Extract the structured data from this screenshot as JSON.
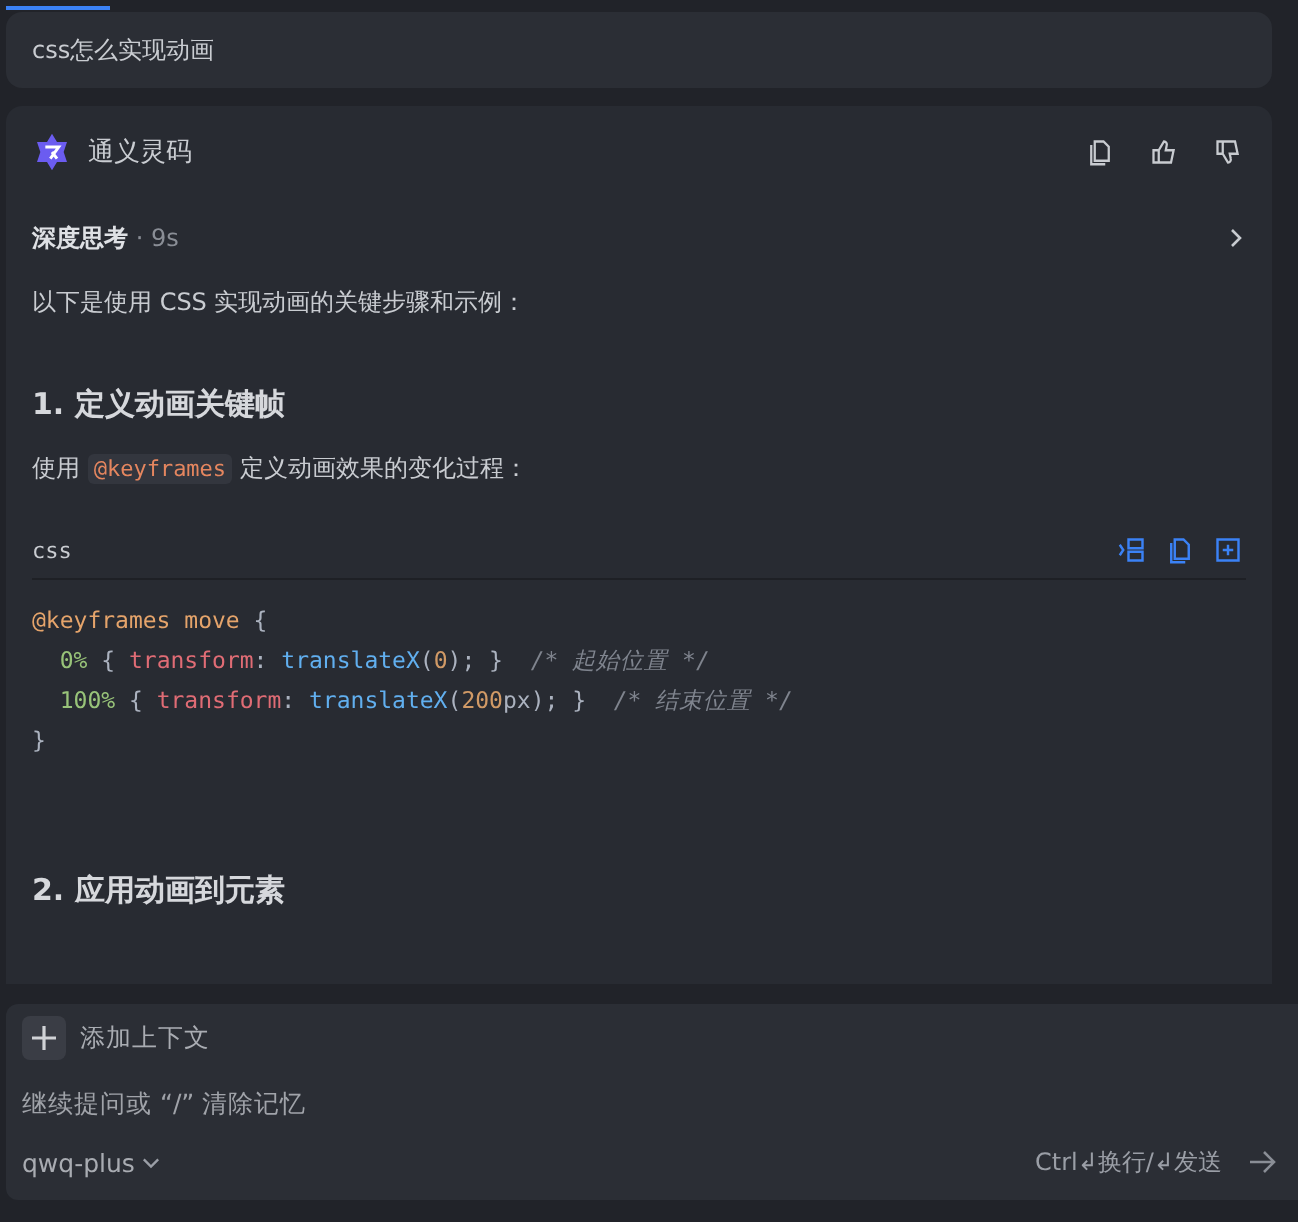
{
  "user_message": "css怎么实现动画",
  "answer": {
    "assistant_name": "通义灵码",
    "thinking": {
      "label": "深度思考",
      "duration": "· 9s",
      "expanded": false
    },
    "intro": "以下是使用 CSS 实现动画的关键步骤和示例：",
    "heading_1": "1. 定义动画关键帧",
    "paragraph": {
      "before": "使用",
      "code": "@keyframes",
      "after": "定义动画效果的变化过程："
    },
    "code_block": {
      "language": "css",
      "lines": [
        [
          {
            "kind": "at",
            "text": "@keyframes move"
          },
          {
            "kind": "plain",
            "text": " {"
          }
        ],
        [
          {
            "kind": "selector",
            "text": "  0%"
          },
          {
            "kind": "plain",
            "text": " { "
          },
          {
            "kind": "property",
            "text": "transform"
          },
          {
            "kind": "plain",
            "text": ": "
          },
          {
            "kind": "function",
            "text": "translateX"
          },
          {
            "kind": "plain",
            "text": "("
          },
          {
            "kind": "number",
            "text": "0"
          },
          {
            "kind": "plain",
            "text": "); }  "
          },
          {
            "kind": "comment",
            "text": "/* 起始位置 */"
          }
        ],
        [
          {
            "kind": "selector",
            "text": "  100%"
          },
          {
            "kind": "plain",
            "text": " { "
          },
          {
            "kind": "property",
            "text": "transform"
          },
          {
            "kind": "plain",
            "text": ": "
          },
          {
            "kind": "function",
            "text": "translateX"
          },
          {
            "kind": "plain",
            "text": "("
          },
          {
            "kind": "number",
            "text": "200"
          },
          {
            "kind": "plain",
            "text": "px); }  "
          },
          {
            "kind": "comment",
            "text": "/* 结束位置 */"
          }
        ],
        [
          {
            "kind": "plain",
            "text": "}"
          }
        ]
      ]
    },
    "heading_2": "2. 应用动画到元素"
  },
  "composer": {
    "add_context": "添加上下文",
    "placeholder": "继续提问或 “/” 清除记忆",
    "model": "qwq-plus",
    "shortcut_hint": "Ctrl↲换行/↲发送"
  }
}
